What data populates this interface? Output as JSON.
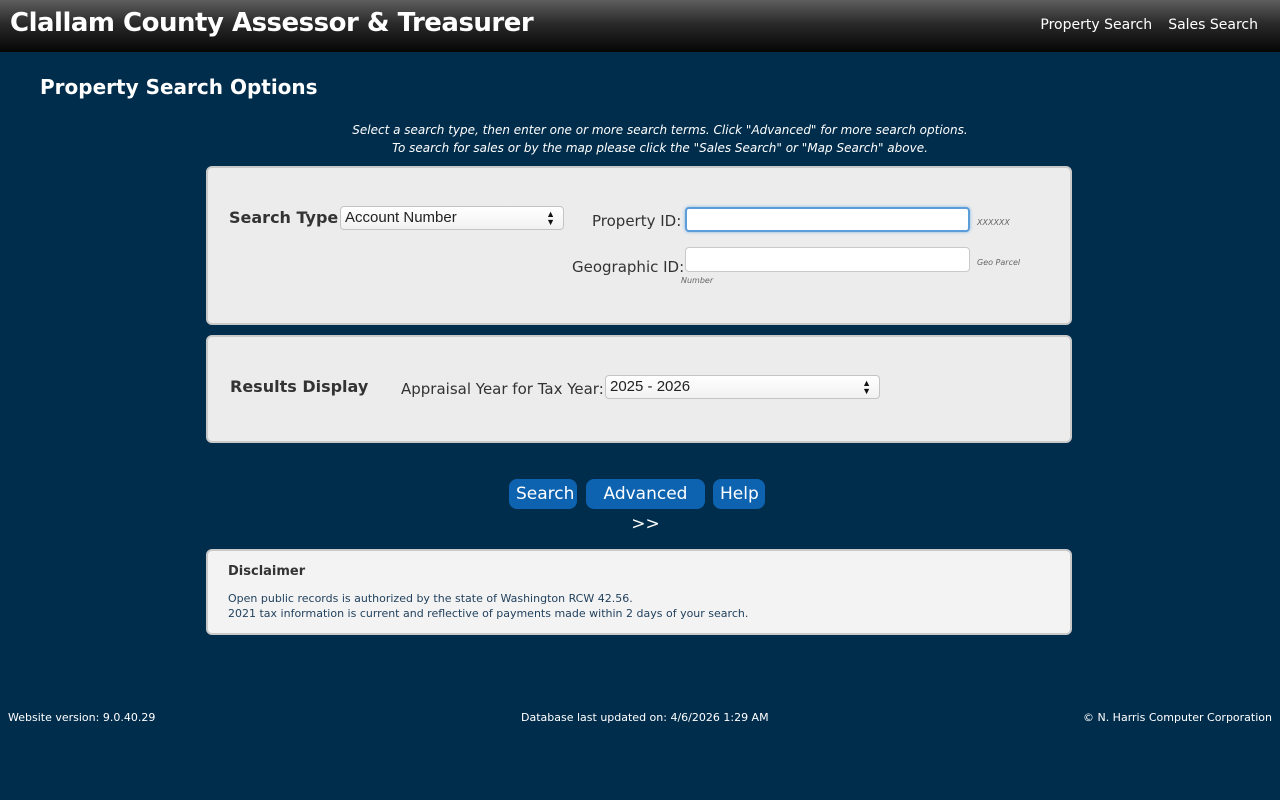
{
  "header": {
    "title": "Clallam County Assessor & Treasurer",
    "nav": [
      "Property Search",
      "Sales Search"
    ]
  },
  "page": {
    "title": "Property Search Options",
    "instructions": [
      "Select a search type, then enter one or more search terms. Click \"Advanced\" for more search options.",
      "To search for sales or by the map please click the \"Sales Search\" or \"Map Search\" above."
    ]
  },
  "search": {
    "type_label": "Search Type:",
    "type_value": "Account Number",
    "property_id_label": "Property ID:",
    "property_id_value": "",
    "property_id_hint": "XXXXXX",
    "geo_id_label": "Geographic ID:",
    "geo_id_value": "",
    "geo_id_hint_1": "Geo Parcel",
    "geo_id_hint_2": "Number"
  },
  "results": {
    "title": "Results Display",
    "year_label": "Appraisal Year for Tax Year:",
    "year_value": "2025 - 2026"
  },
  "buttons": {
    "search": "Search",
    "advanced": "Advanced >>",
    "help": "Help"
  },
  "disclaimer": {
    "title": "Disclaimer",
    "line1": "Open public records is authorized by the state of Washington RCW 42.56.",
    "line2": "2021 tax information is current and reflective of payments made within 2 days of your search."
  },
  "footer": {
    "version": "Website version: 9.0.40.29",
    "db_updated": "Database last updated on: 4/6/2026 1:29 AM",
    "copyright": "© N. Harris Computer Corporation"
  },
  "icons": {
    "select_arrow": "up-down-arrows-icon"
  }
}
